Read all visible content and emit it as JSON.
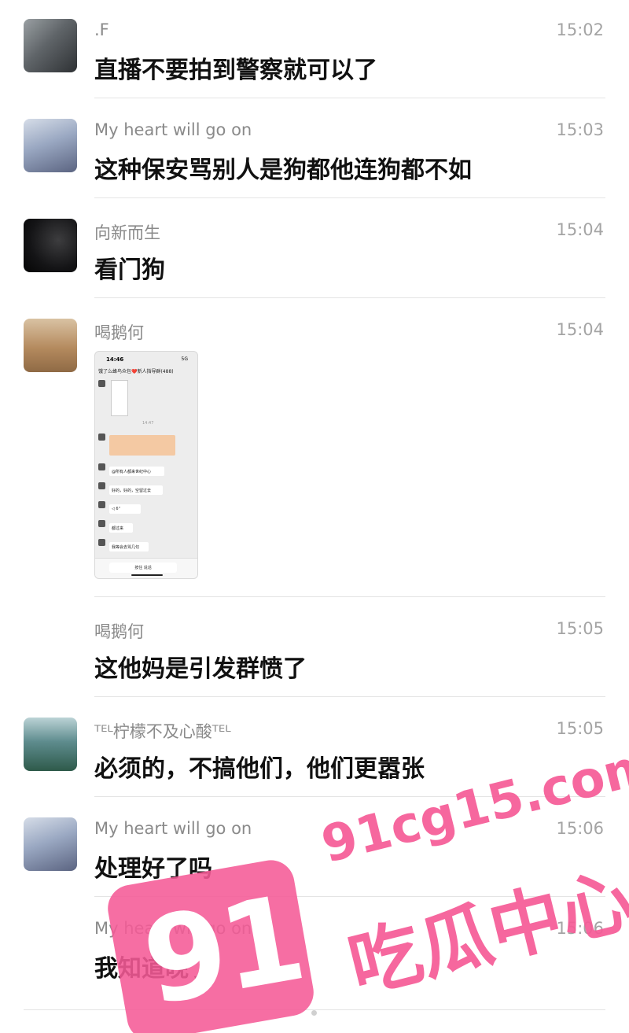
{
  "messages": [
    {
      "name": ".F",
      "time": "15:02",
      "text": "直播不要拍到警察就可以了",
      "avatar": "avatar-f"
    },
    {
      "name": "My heart will go on",
      "time": "15:03",
      "text": "这种保安骂别人是狗都他连狗都不如",
      "avatar": "avatar-heart"
    },
    {
      "name": "向新而生",
      "time": "15:04",
      "text": "看门狗",
      "avatar": "avatar-xiang"
    },
    {
      "name": "喝鹅何",
      "time": "15:04",
      "text": "",
      "avatar": "avatar-dog"
    },
    {
      "name": "喝鹅何",
      "time": "15:05",
      "text": "这他妈是引发群愤了"
    },
    {
      "name": "ᵀᴱᴸ柠檬不及心酸ᵀᴱᴸ",
      "time": "15:05",
      "text": "必须的，不搞他们，他们更嚣张",
      "avatar": "avatar-lemon"
    },
    {
      "name": "My heart will go on",
      "time": "15:06",
      "text": "处理好了吗",
      "avatar": "avatar-heart"
    },
    {
      "name": "My heart will go on",
      "time": "15:06",
      "text": "我知道晚了"
    }
  ],
  "screenshot": {
    "status_time": "14:46",
    "status_right": "5G",
    "header": "饿了么蜂鸟众包❤️新人指导群(488)",
    "time_label": "14:47",
    "bubbles": [
      "@所有人都来世纪中心",
      "好的，好的，空留过去",
      "◁ 6\"",
      "都过来",
      "我等会去骂几句"
    ],
    "input_label": "按住 说话"
  },
  "watermark": {
    "number": "91",
    "url": "91cg15.com",
    "brand": "吃瓜中心"
  }
}
